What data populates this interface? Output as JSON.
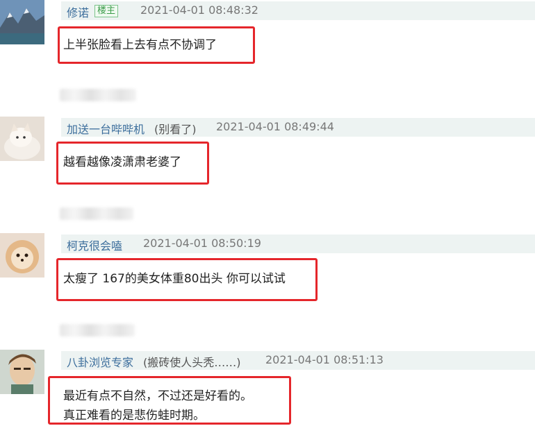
{
  "posts": [
    {
      "username": "修诺",
      "badge": "楼主",
      "extra": "",
      "time": "2021-04-01 08:48:32",
      "lines": [
        "上半张脸看上去有点不协调了"
      ]
    },
    {
      "username": "加送一台哔哔机",
      "badge": "",
      "extra": "(别看了)",
      "time": "2021-04-01 08:49:44",
      "lines": [
        "越看越像凌潇肃老婆了"
      ]
    },
    {
      "username": "柯克很会嗑",
      "badge": "",
      "extra": "",
      "time": "2021-04-01 08:50:19",
      "lines": [
        "太瘦了 167的美女体重80出头 你可以试试"
      ]
    },
    {
      "username": "八卦浏览专家",
      "badge": "",
      "extra": "(搬砖使人头秃……)",
      "time": "2021-04-01 08:51:13",
      "lines": [
        "最近有点不自然，不过还是好看的。",
        "真正难看的是悲伤蛙时期。"
      ]
    }
  ],
  "colors": {
    "highlight_border": "#e5262b",
    "username": "#3c6e9c",
    "header_bg": "#edf3f2"
  }
}
